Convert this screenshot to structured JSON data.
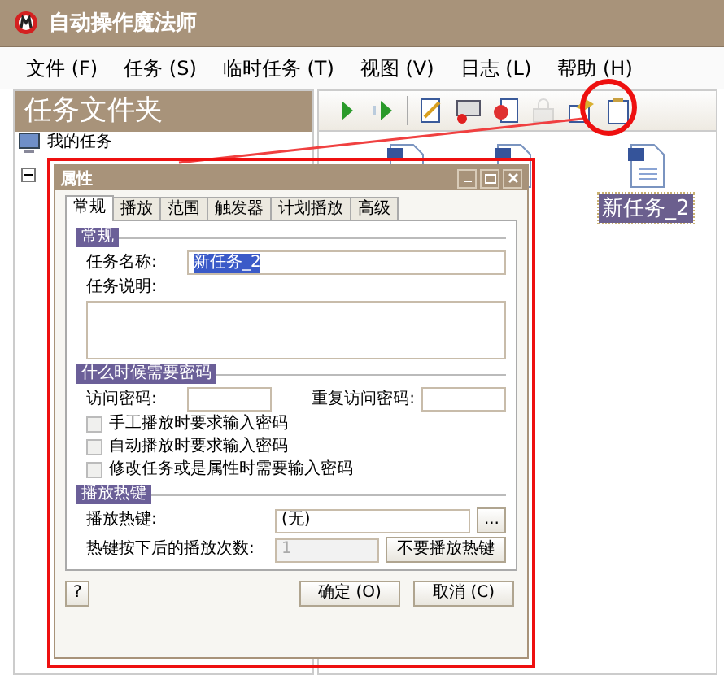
{
  "window": {
    "title": "自动操作魔法师"
  },
  "menu": [
    {
      "label": "文件 (F)"
    },
    {
      "label": "任务 (S)"
    },
    {
      "label": "临时任务 (T)"
    },
    {
      "label": "视图 (V)"
    },
    {
      "label": "日志 (L)"
    },
    {
      "label": "帮助 (H)"
    }
  ],
  "sidebar": {
    "title": "任务文件夹",
    "tree": [
      {
        "label": "我的任务",
        "expanded": true
      }
    ]
  },
  "toolbar": [
    {
      "kind": "play",
      "disabled": false
    },
    {
      "kind": "step",
      "disabled": false
    },
    {
      "kind": "edit",
      "disabled": false
    },
    {
      "kind": "record",
      "disabled": false
    },
    {
      "kind": "delete",
      "disabled": false
    },
    {
      "kind": "lock",
      "disabled": true
    },
    {
      "kind": "properties",
      "disabled": false
    },
    {
      "kind": "clipboard",
      "disabled": false
    }
  ],
  "tasks": [
    {
      "label": "新任务_2",
      "selected": true
    }
  ],
  "dialog": {
    "title": "属性",
    "tabs": [
      {
        "label": "常规",
        "selected": true
      },
      {
        "label": "播放",
        "selected": false
      },
      {
        "label": "范围",
        "selected": false
      },
      {
        "label": "触发器",
        "selected": false
      },
      {
        "label": "计划播放",
        "selected": false
      },
      {
        "label": "高级",
        "selected": false
      }
    ],
    "general": {
      "heading": "常规",
      "name_label": "任务名称:",
      "name_value": "新任务_2",
      "description_label": "任务说明:"
    },
    "password": {
      "heading": "什么时候需要密码",
      "access_label": "访问密码:",
      "repeat_label": "重复访问密码:",
      "options": [
        {
          "label": "手工播放时要求输入密码",
          "checked": false
        },
        {
          "label": "自动播放时要求输入密码",
          "checked": false
        },
        {
          "label": "修改任务或是属性时需要输入密码",
          "checked": false
        }
      ]
    },
    "hotkey": {
      "heading": "播放热键",
      "hotkey_label": "播放热键:",
      "hotkey_value": "(无)",
      "browse_button": "...",
      "count_label": "热键按下后的播放次数:",
      "count_value": "1",
      "count_disabled": true,
      "clear_button": "不要播放热键"
    },
    "help_button": "?",
    "buttons": [
      "确定 (O)",
      "取消 (C)"
    ]
  }
}
